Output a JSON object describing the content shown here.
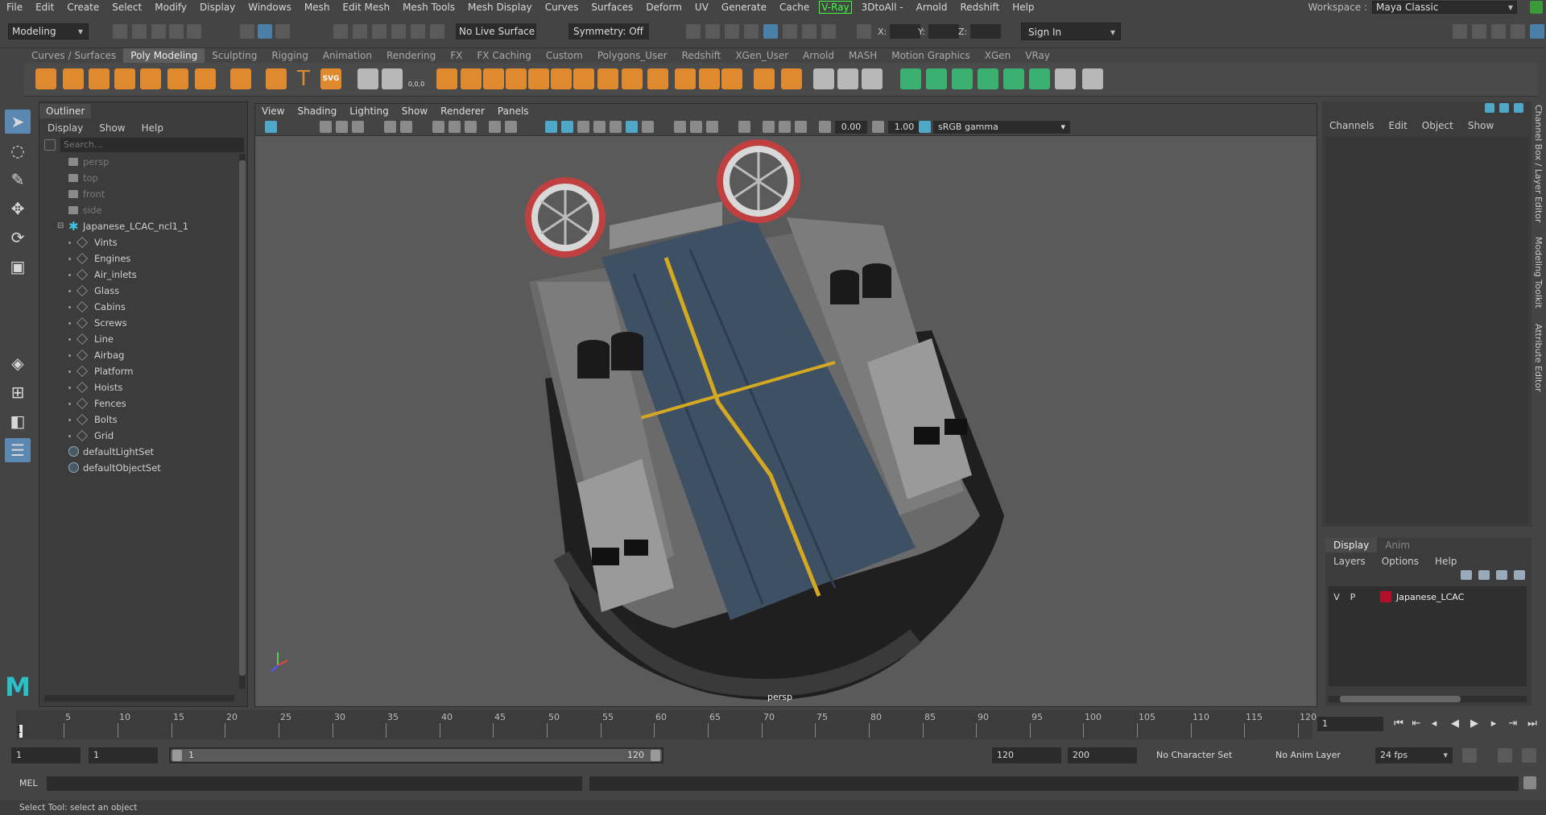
{
  "menubar": {
    "items": [
      "File",
      "Edit",
      "Create",
      "Select",
      "Modify",
      "Display",
      "Windows",
      "Mesh",
      "Edit Mesh",
      "Mesh Tools",
      "Mesh Display",
      "Curves",
      "Surfaces",
      "Deform",
      "UV",
      "Generate",
      "Cache",
      "V-Ray",
      "3DtoAll -",
      "Arnold",
      "Redshift",
      "Help"
    ],
    "workspace_label": "Workspace :",
    "workspace_value": "Maya Classic"
  },
  "statusline": {
    "mode": "Modeling",
    "live_surface": "No Live Surface",
    "symmetry": "Symmetry: Off",
    "x_label": "X:",
    "y_label": "Y:",
    "z_label": "Z:",
    "sign_in": "Sign In"
  },
  "shelf": {
    "tabs": [
      "Curves / Surfaces",
      "Poly Modeling",
      "Sculpting",
      "Rigging",
      "Animation",
      "Rendering",
      "FX",
      "FX Caching",
      "Custom",
      "Polygons_User",
      "Redshift",
      "XGen_User",
      "Arnold",
      "MASH",
      "Motion Graphics",
      "XGen",
      "VRay"
    ],
    "active_tab": "Poly Modeling",
    "text_icon": "T",
    "svg_icon": "SVG",
    "coord_icon": "0,0,0"
  },
  "outliner": {
    "title": "Outliner",
    "menu": [
      "Display",
      "Show",
      "Help"
    ],
    "search_placeholder": "Search...",
    "cameras": [
      "persp",
      "top",
      "front",
      "side"
    ],
    "root": "Japanese_LCAC_ncl1_1",
    "children": [
      "Vints",
      "Engines",
      "Air_inlets",
      "Glass",
      "Cabins",
      "Screws",
      "Line",
      "Airbag",
      "Platform",
      "Hoists",
      "Fences",
      "Bolts",
      "Grid"
    ],
    "sets": [
      "defaultLightSet",
      "defaultObjectSet"
    ]
  },
  "viewport": {
    "menu": [
      "View",
      "Shading",
      "Lighting",
      "Show",
      "Renderer",
      "Panels"
    ],
    "value_a": "0.00",
    "value_b": "1.00",
    "color_space": "sRGB gamma",
    "camera_label": "persp"
  },
  "channelbox": {
    "menu": [
      "Channels",
      "Edit",
      "Object",
      "Show"
    ],
    "side_tabs": [
      "Channel Box / Layer Editor",
      "Modeling Toolkit",
      "Attribute Editor"
    ]
  },
  "layereditor": {
    "tabs": [
      "Display",
      "Anim"
    ],
    "active_tab": "Display",
    "menu": [
      "Layers",
      "Options",
      "Help"
    ],
    "layer": {
      "v": "V",
      "p": "P",
      "name": "Japanese_LCAC",
      "color": "#b0102a"
    }
  },
  "timeline": {
    "ticks": [
      "5",
      "10",
      "15",
      "20",
      "25",
      "30",
      "35",
      "40",
      "45",
      "50",
      "55",
      "60",
      "65",
      "70",
      "75",
      "80",
      "85",
      "90",
      "95",
      "100",
      "105",
      "110",
      "115",
      "120"
    ],
    "playhead": "1",
    "current_frame": "1"
  },
  "rangebar": {
    "start": "1",
    "playback_start": "1",
    "slider_start": "1",
    "slider_end": "120",
    "playback_end": "120",
    "end": "200",
    "character_set": "No Character Set",
    "anim_layer": "No Anim Layer",
    "fps": "24 fps"
  },
  "cmdline": {
    "label": "MEL",
    "help": "Select Tool: select an object"
  },
  "colors": {
    "accent": "#4fa8c8",
    "shelf_orange": "#e08a30",
    "vray_green": "#3cff3c",
    "layer_red": "#b0102a"
  }
}
